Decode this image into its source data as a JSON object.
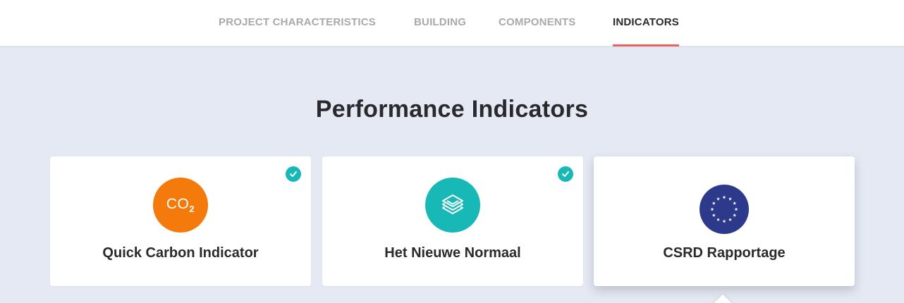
{
  "nav": {
    "tabs": [
      {
        "label": "PROJECT CHARACTERISTICS",
        "active": false
      },
      {
        "label": "BUILDING",
        "active": false
      },
      {
        "label": "COMPONENTS",
        "active": false
      },
      {
        "label": "INDICATORS",
        "active": true
      }
    ],
    "accent_color": "#e8625e"
  },
  "main": {
    "title": "Performance Indicators",
    "cards": [
      {
        "label": "Quick Carbon Indicator",
        "icon": "co2-icon",
        "icon_text": "CO",
        "icon_sub": "2",
        "icon_color": "#f47a0b",
        "checked": true
      },
      {
        "label": "Het Nieuwe Normaal",
        "icon": "layers-icon",
        "icon_color": "#17b8b6",
        "checked": true
      },
      {
        "label": "CSRD Rapportage",
        "icon": "eu-flag-icon",
        "icon_color": "#2d3a8c",
        "checked": false
      }
    ],
    "check_color": "#17b8b6"
  }
}
